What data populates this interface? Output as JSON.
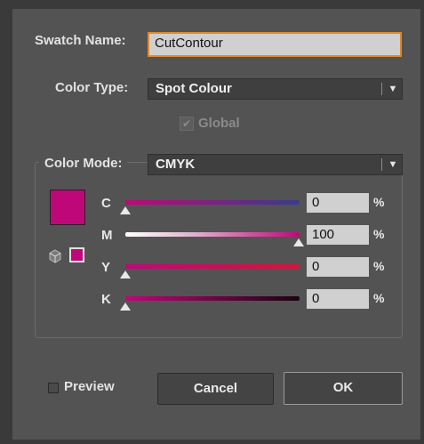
{
  "swatch_name": {
    "label": "Swatch Name:",
    "value": "CutContour"
  },
  "color_type": {
    "label": "Color Type:",
    "value": "Spot Colour"
  },
  "global": {
    "label": "Global",
    "checked": true,
    "enabled": false
  },
  "color_mode": {
    "label": "Color Mode:",
    "value": "CMYK"
  },
  "swatch_color": "#c0077a",
  "channels": [
    {
      "label": "C",
      "value": "0",
      "level": 0
    },
    {
      "label": "M",
      "value": "100",
      "level": 1
    },
    {
      "label": "Y",
      "value": "0",
      "level": 0
    },
    {
      "label": "K",
      "value": "0",
      "level": 0
    }
  ],
  "percent_sign": "%",
  "preview": {
    "label": "Preview",
    "checked": false
  },
  "buttons": {
    "cancel": "Cancel",
    "ok": "OK"
  },
  "icons": {
    "gamut": "cube-icon",
    "dropdown": "chevron-down-icon",
    "check": "checkmark-icon",
    "slider_thumb": "triangle-slider-icon"
  }
}
